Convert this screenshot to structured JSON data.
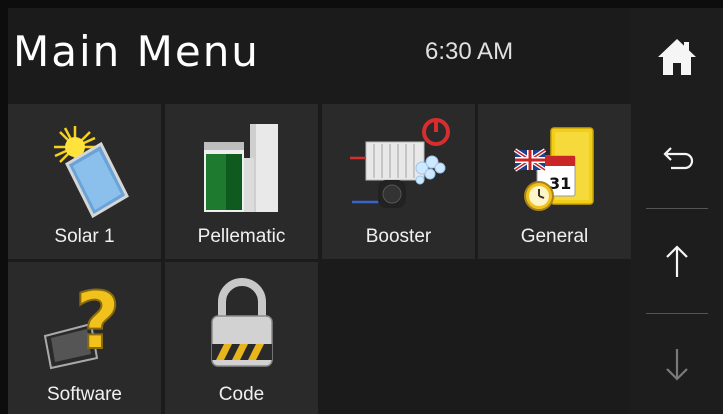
{
  "header": {
    "title": "Main Menu",
    "time": "6:30 AM"
  },
  "sidebar": {
    "home_icon": "home-icon",
    "back_icon": "back-arrow-icon",
    "up_icon": "up-arrow-icon",
    "down_icon": "down-arrow-icon",
    "down_enabled": false
  },
  "menu": {
    "items": [
      {
        "label": "Solar 1",
        "icon": "solar-panel-icon"
      },
      {
        "label": "Pellematic",
        "icon": "pellet-boiler-icon"
      },
      {
        "label": "Booster",
        "icon": "booster-heat-pump-icon"
      },
      {
        "label": "General",
        "icon": "general-settings-icon"
      },
      {
        "label": "Software",
        "icon": "software-help-icon"
      },
      {
        "label": "Code",
        "icon": "padlock-icon"
      }
    ]
  },
  "colors": {
    "background": "#1b1b1b",
    "tile": "#2a2a2a",
    "text": "#ffffff"
  }
}
